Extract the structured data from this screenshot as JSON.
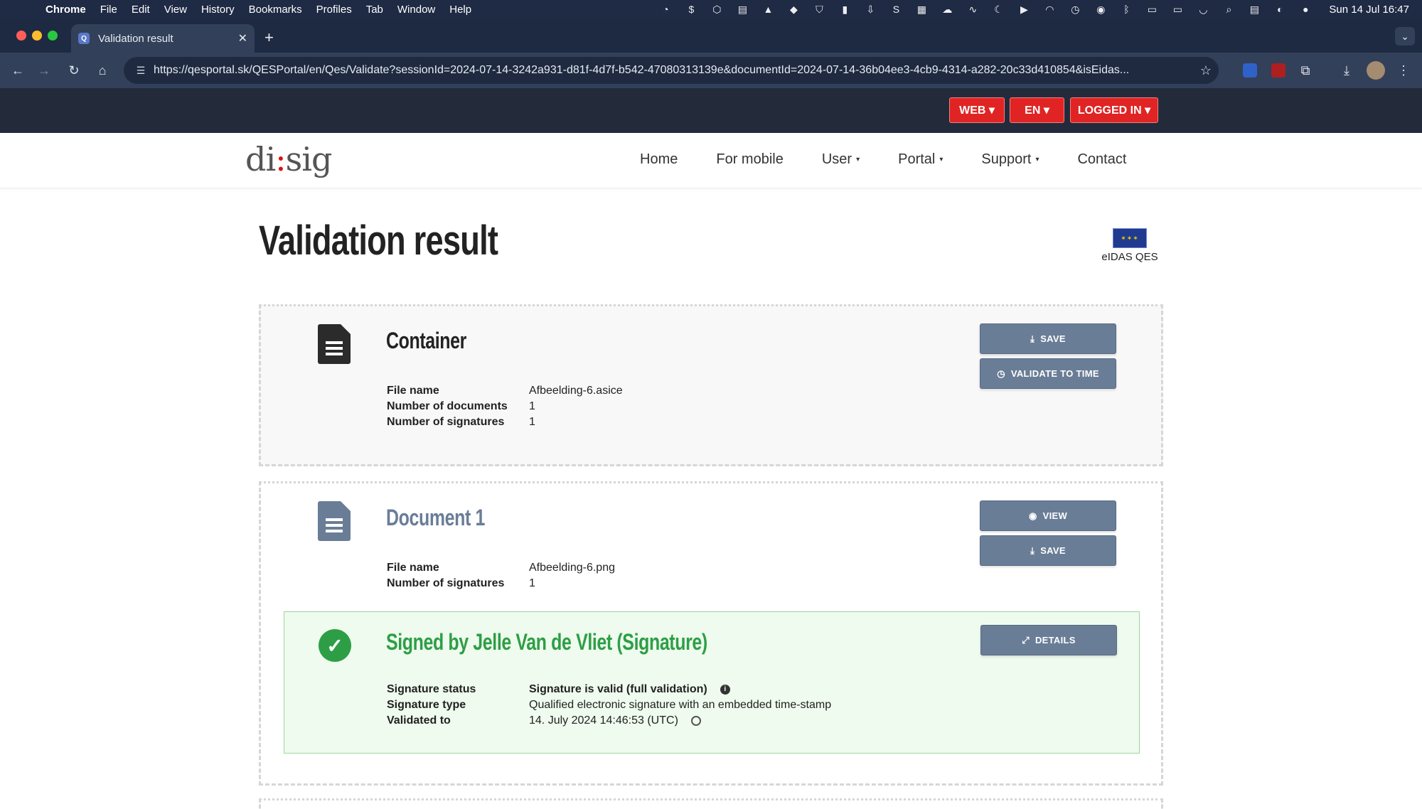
{
  "system_bar": {
    "app": "Chrome",
    "menus": [
      "File",
      "Edit",
      "View",
      "History",
      "Bookmarks",
      "Profiles",
      "Tab",
      "Window",
      "Help"
    ],
    "clock": "Sun 14 Jul  16:47"
  },
  "browser": {
    "tab_title": "Validation result",
    "favicon_letter": "Q",
    "new_tab_symbol": "+",
    "url": "https://qesportal.sk/QESPortal/en/Qes/Validate?sessionId=2024-07-14-3242a931-d81f-4d7f-b542-47080313139e&documentId=2024-07-14-36b04ee3-4cb9-4314-a282-20c33d410854&isEidas..."
  },
  "topbar": {
    "web_label": "WEB ▾",
    "lang_label": "EN ▾",
    "login_label": "LOGGED IN ▾"
  },
  "navbar": {
    "logo_left": "di",
    "logo_colon": ":",
    "logo_right": "sig",
    "links": [
      "Home",
      "For mobile",
      "User",
      "Portal",
      "Support",
      "Contact"
    ],
    "dropdown_caret": "▾"
  },
  "main": {
    "title": "Validation result",
    "eidas_label": "eIDAS QES",
    "container": {
      "title": "Container",
      "rows": [
        {
          "key": "File name",
          "value": "Afbeelding-6.asice"
        },
        {
          "key": "Number of documents",
          "value": "1"
        },
        {
          "key": "Number of signatures",
          "value": "1"
        }
      ],
      "save_label": "SAVE",
      "validate_label": "VALIDATE TO TIME"
    },
    "document": {
      "title": "Document 1",
      "rows": [
        {
          "key": "File name",
          "value": "Afbeelding-6.png"
        },
        {
          "key": "Number of signatures",
          "value": "1"
        }
      ],
      "view_label": "VIEW",
      "save_label": "SAVE"
    },
    "signature": {
      "title": "Signed by Jelle Van de Vliet (Signature)",
      "details_label": "DETAILS",
      "rows": [
        {
          "key": "Signature status",
          "value": "Signature is valid (full validation)"
        },
        {
          "key": "Signature type",
          "value": "Qualified electronic signature with an embedded time-stamp"
        },
        {
          "key": "Validated to",
          "value": "14. July 2024 14:46:53 (UTC)"
        }
      ]
    }
  },
  "colors": {
    "topbar_bg": "#232b3b",
    "red_button": "#e02424",
    "action_button": "#6a7d97",
    "valid_green": "#2e9e46",
    "valid_bg": "#eefbee"
  }
}
